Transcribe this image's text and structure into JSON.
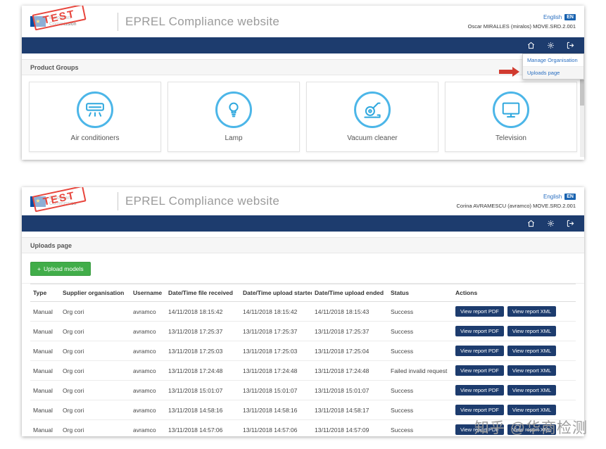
{
  "top": {
    "logo": {
      "stamp": "TEST",
      "org_line1": "European",
      "org_line2": "Commission"
    },
    "title": "EPREL Compliance website",
    "lang_label": "English",
    "lang_code": "EN",
    "user": "Oscar MIRALLES (miralos) MOVE.SRD.2.001",
    "menu": {
      "item1": "Manage Organisation",
      "item2": "Uploads page"
    },
    "section": "Product Groups",
    "cards": [
      {
        "label": "Air conditioners"
      },
      {
        "label": "Lamp"
      },
      {
        "label": "Vacuum cleaner"
      },
      {
        "label": "Television"
      }
    ]
  },
  "bottom": {
    "logo": {
      "stamp": "TEST",
      "org_line1": "European",
      "org_line2": "Commission"
    },
    "title": "EPREL Compliance website",
    "lang_label": "English",
    "lang_code": "EN",
    "user": "Corina AVRAMESCU (avramco) MOVE.SRD.2.001",
    "section": "Uploads page",
    "upload_button": {
      "icon": "+",
      "label": "Upload models"
    },
    "table": {
      "headers": [
        "Type",
        "Supplier organisation",
        "Username",
        "Date/Time file received",
        "Date/Time upload started",
        "Date/Time upload ended",
        "Status",
        "Actions"
      ],
      "action_pdf": "View report PDF",
      "action_xml": "View report XML",
      "rows": [
        {
          "type": "Manual",
          "org": "Org cori",
          "username": "avramco",
          "received": "14/11/2018 18:15:42",
          "started": "14/11/2018 18:15:42",
          "ended": "14/11/2018 18:15:43",
          "status": "Success"
        },
        {
          "type": "Manual",
          "org": "Org cori",
          "username": "avramco",
          "received": "13/11/2018 17:25:37",
          "started": "13/11/2018 17:25:37",
          "ended": "13/11/2018 17:25:37",
          "status": "Success"
        },
        {
          "type": "Manual",
          "org": "Org cori",
          "username": "avramco",
          "received": "13/11/2018 17:25:03",
          "started": "13/11/2018 17:25:03",
          "ended": "13/11/2018 17:25:04",
          "status": "Success"
        },
        {
          "type": "Manual",
          "org": "Org cori",
          "username": "avramco",
          "received": "13/11/2018 17:24:48",
          "started": "13/11/2018 17:24:48",
          "ended": "13/11/2018 17:24:48",
          "status": "Failed invalid request"
        },
        {
          "type": "Manual",
          "org": "Org cori",
          "username": "avramco",
          "received": "13/11/2018 15:01:07",
          "started": "13/11/2018 15:01:07",
          "ended": "13/11/2018 15:01:07",
          "status": "Success"
        },
        {
          "type": "Manual",
          "org": "Org cori",
          "username": "avramco",
          "received": "13/11/2018 14:58:16",
          "started": "13/11/2018 14:58:16",
          "ended": "13/11/2018 14:58:17",
          "status": "Success"
        },
        {
          "type": "Manual",
          "org": "Org cori",
          "username": "avramco",
          "received": "13/11/2018 14:57:06",
          "started": "13/11/2018 14:57:06",
          "ended": "13/11/2018 14:57:09",
          "status": "Success"
        }
      ]
    }
  },
  "colors": {
    "navy": "#1d3c6e",
    "accent_blue": "#2fa8de",
    "green": "#41ad49",
    "stamp_red": "#e8453c",
    "badge_blue": "#1a63b0"
  },
  "watermark": "知乎 @华商检测"
}
